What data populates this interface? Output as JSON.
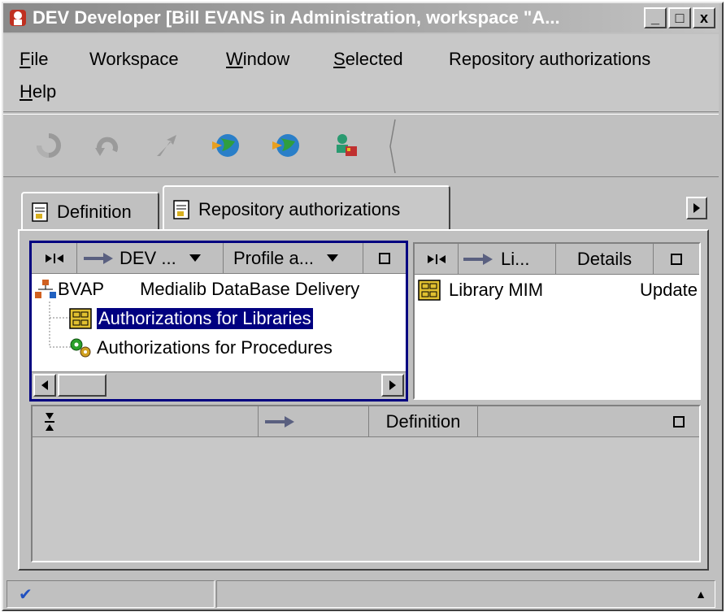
{
  "window": {
    "title": "DEV Developer [Bill EVANS in Administration, workspace \"A...",
    "buttons": [
      "_",
      "□",
      "x"
    ]
  },
  "menu": {
    "items": [
      {
        "pre": "",
        "u": "F",
        "post": "ile"
      },
      {
        "pre": "Workspace",
        "u": "",
        "post": ""
      },
      {
        "pre": "",
        "u": "W",
        "post": "indow"
      },
      {
        "pre": "",
        "u": "S",
        "post": "elected"
      },
      {
        "pre": "Repository authorizations",
        "u": "",
        "post": ""
      },
      {
        "pre": "",
        "u": "H",
        "post": "elp"
      }
    ]
  },
  "toolbar": {
    "icons": [
      "refresh-icon",
      "undo-icon",
      "navigate-icon",
      "globe-arrow-icon",
      "globe-arrow-icon",
      "user-key-icon"
    ]
  },
  "tabs": {
    "definition": "Definition",
    "repository": "Repository authorizations"
  },
  "left_pane": {
    "header": {
      "col1": "DEV ...",
      "col2": "Profile a..."
    },
    "root": {
      "name": "BVAP",
      "desc": "Medialib DataBase Delivery"
    },
    "children": [
      {
        "label": "Authorizations for Libraries",
        "selected": true
      },
      {
        "label": "Authorizations for Procedures",
        "selected": false
      }
    ]
  },
  "right_pane": {
    "header": {
      "col1": "Li...",
      "col2": "Details"
    },
    "rows": [
      {
        "name": "Library MIM",
        "detail": "Update"
      }
    ]
  },
  "bottom_pane": {
    "header": {
      "col2": "Definition"
    }
  },
  "status": {
    "check": "✔",
    "scroll_up": "▲"
  },
  "colors": {
    "selection": "#000080",
    "face": "#c0c0c0"
  }
}
